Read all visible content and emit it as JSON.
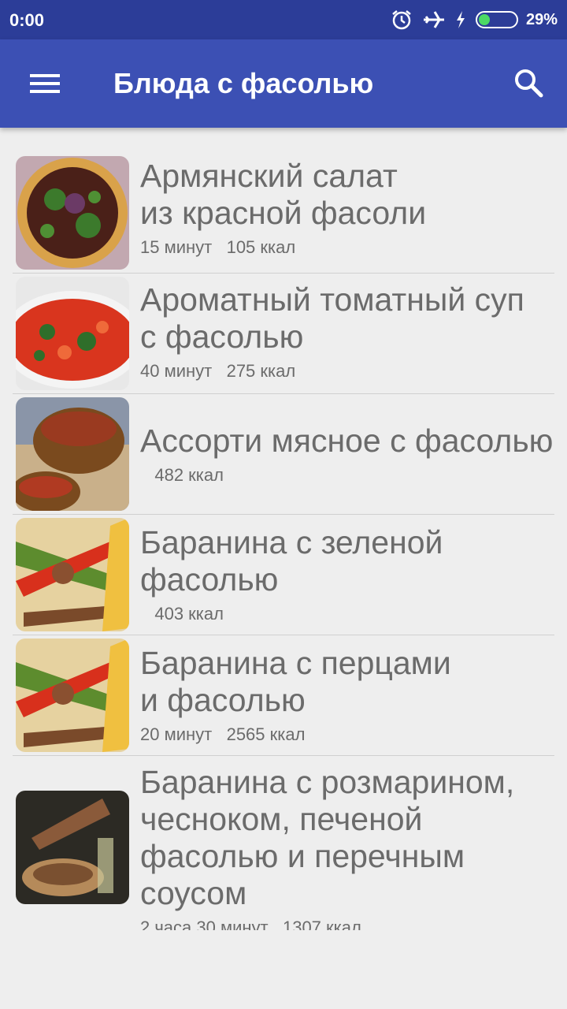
{
  "status_bar": {
    "time": "0:00",
    "battery_percent": "29%",
    "battery_level": 0.29,
    "icons": [
      "alarm-icon",
      "airplane-mode-icon",
      "charging-icon",
      "battery-icon"
    ]
  },
  "app_bar": {
    "title": "Блюда с фасолью",
    "menu_icon": "menu-icon",
    "search_icon": "search-icon",
    "color": "#3c50b4"
  },
  "recipes": [
    {
      "title": "Армянский салат\nиз красной фасоли",
      "time": "15 минут",
      "calories": "105 ккал",
      "thumb": "bean-salad-image"
    },
    {
      "title": "Ароматный томатный суп\nс фасолью",
      "time": "40 минут",
      "calories": "275 ккал",
      "thumb": "tomato-soup-image"
    },
    {
      "title": "Ассорти мясное с фасолью",
      "time": "",
      "calories": "482 ккал",
      "thumb": "meat-pot-image"
    },
    {
      "title": "Баранина с зеленой\nфасолью",
      "time": "",
      "calories": "403 ккал",
      "thumb": "lamb-green-beans-image"
    },
    {
      "title": "Баранина с перцами\nи фасолью",
      "time": "20 минут",
      "calories": "2565 ккал",
      "thumb": "lamb-peppers-image"
    },
    {
      "title": "Баранина с розмарином,\nчесноком, печеной\nфасолью и перечным\nсоусом",
      "time": "2 часа 30 минут",
      "calories": "1307 ккал",
      "thumb": "lamb-rosemary-image"
    }
  ]
}
